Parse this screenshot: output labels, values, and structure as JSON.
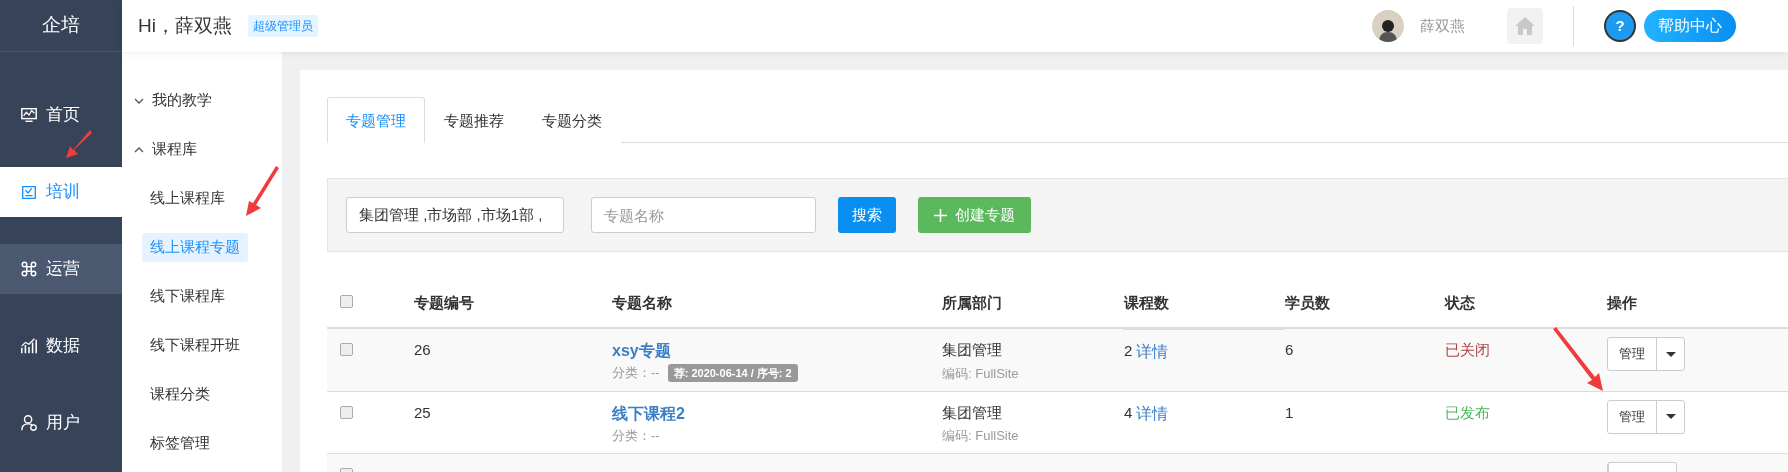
{
  "brand": "企培",
  "greeting": "Hi，薛双燕",
  "role_badge": "超级管理员",
  "user": {
    "name": "薛双燕"
  },
  "help": {
    "mark": "?",
    "label": "帮助中心"
  },
  "nav": [
    {
      "label": "首页",
      "selected": false,
      "highlighted": false
    },
    {
      "label": "培训",
      "selected": true,
      "highlighted": false
    },
    {
      "label": "运营",
      "selected": false,
      "highlighted": true
    },
    {
      "label": "数据",
      "selected": false,
      "highlighted": false
    },
    {
      "label": "用户",
      "selected": false,
      "highlighted": false
    }
  ],
  "submenu": [
    {
      "kind": "group",
      "label": "我的教学",
      "expanded": false
    },
    {
      "kind": "group",
      "label": "课程库",
      "expanded": true
    },
    {
      "kind": "item",
      "label": "线上课程库",
      "selected": false
    },
    {
      "kind": "item",
      "label": "线上课程专题",
      "selected": true
    },
    {
      "kind": "item",
      "label": "线下课程库",
      "selected": false
    },
    {
      "kind": "item",
      "label": "线下课程开班",
      "selected": false
    },
    {
      "kind": "item",
      "label": "课程分类",
      "selected": false
    },
    {
      "kind": "item",
      "label": "标签管理",
      "selected": false
    }
  ],
  "tabs": [
    {
      "label": "专题管理",
      "selected": true
    },
    {
      "label": "专题推荐",
      "selected": false
    },
    {
      "label": "专题分类",
      "selected": false
    }
  ],
  "filters": {
    "department": "集团管理 ,市场部 ,市场1部 ,",
    "name_placeholder": "专题名称",
    "search": "搜索",
    "create": "创建专题"
  },
  "table": {
    "select_all": false,
    "columns": [
      "专题编号",
      "专题名称",
      "所属部门",
      "课程数",
      "学员数",
      "状态",
      "操作"
    ],
    "rows": [
      {
        "checked": false,
        "id": "26",
        "name": "xsy专题",
        "category": "分类：--",
        "tag": "荐: 2020-06-14 / 序号: 2",
        "department": "集团管理",
        "code": "编码: FullSite",
        "courses": "2",
        "detail": "详情",
        "students": "6",
        "status": "已关闭",
        "color": "#a94442",
        "action": "管理"
      },
      {
        "checked": false,
        "id": "25",
        "name": "线下课程2",
        "category": "分类：--",
        "department": "集团管理",
        "code": "编码: FullSite",
        "courses": "4",
        "detail": "详情",
        "students": "1",
        "status": "已发布",
        "color": "#4cb860",
        "action": "管理"
      },
      {
        "checked": false
      }
    ]
  }
}
